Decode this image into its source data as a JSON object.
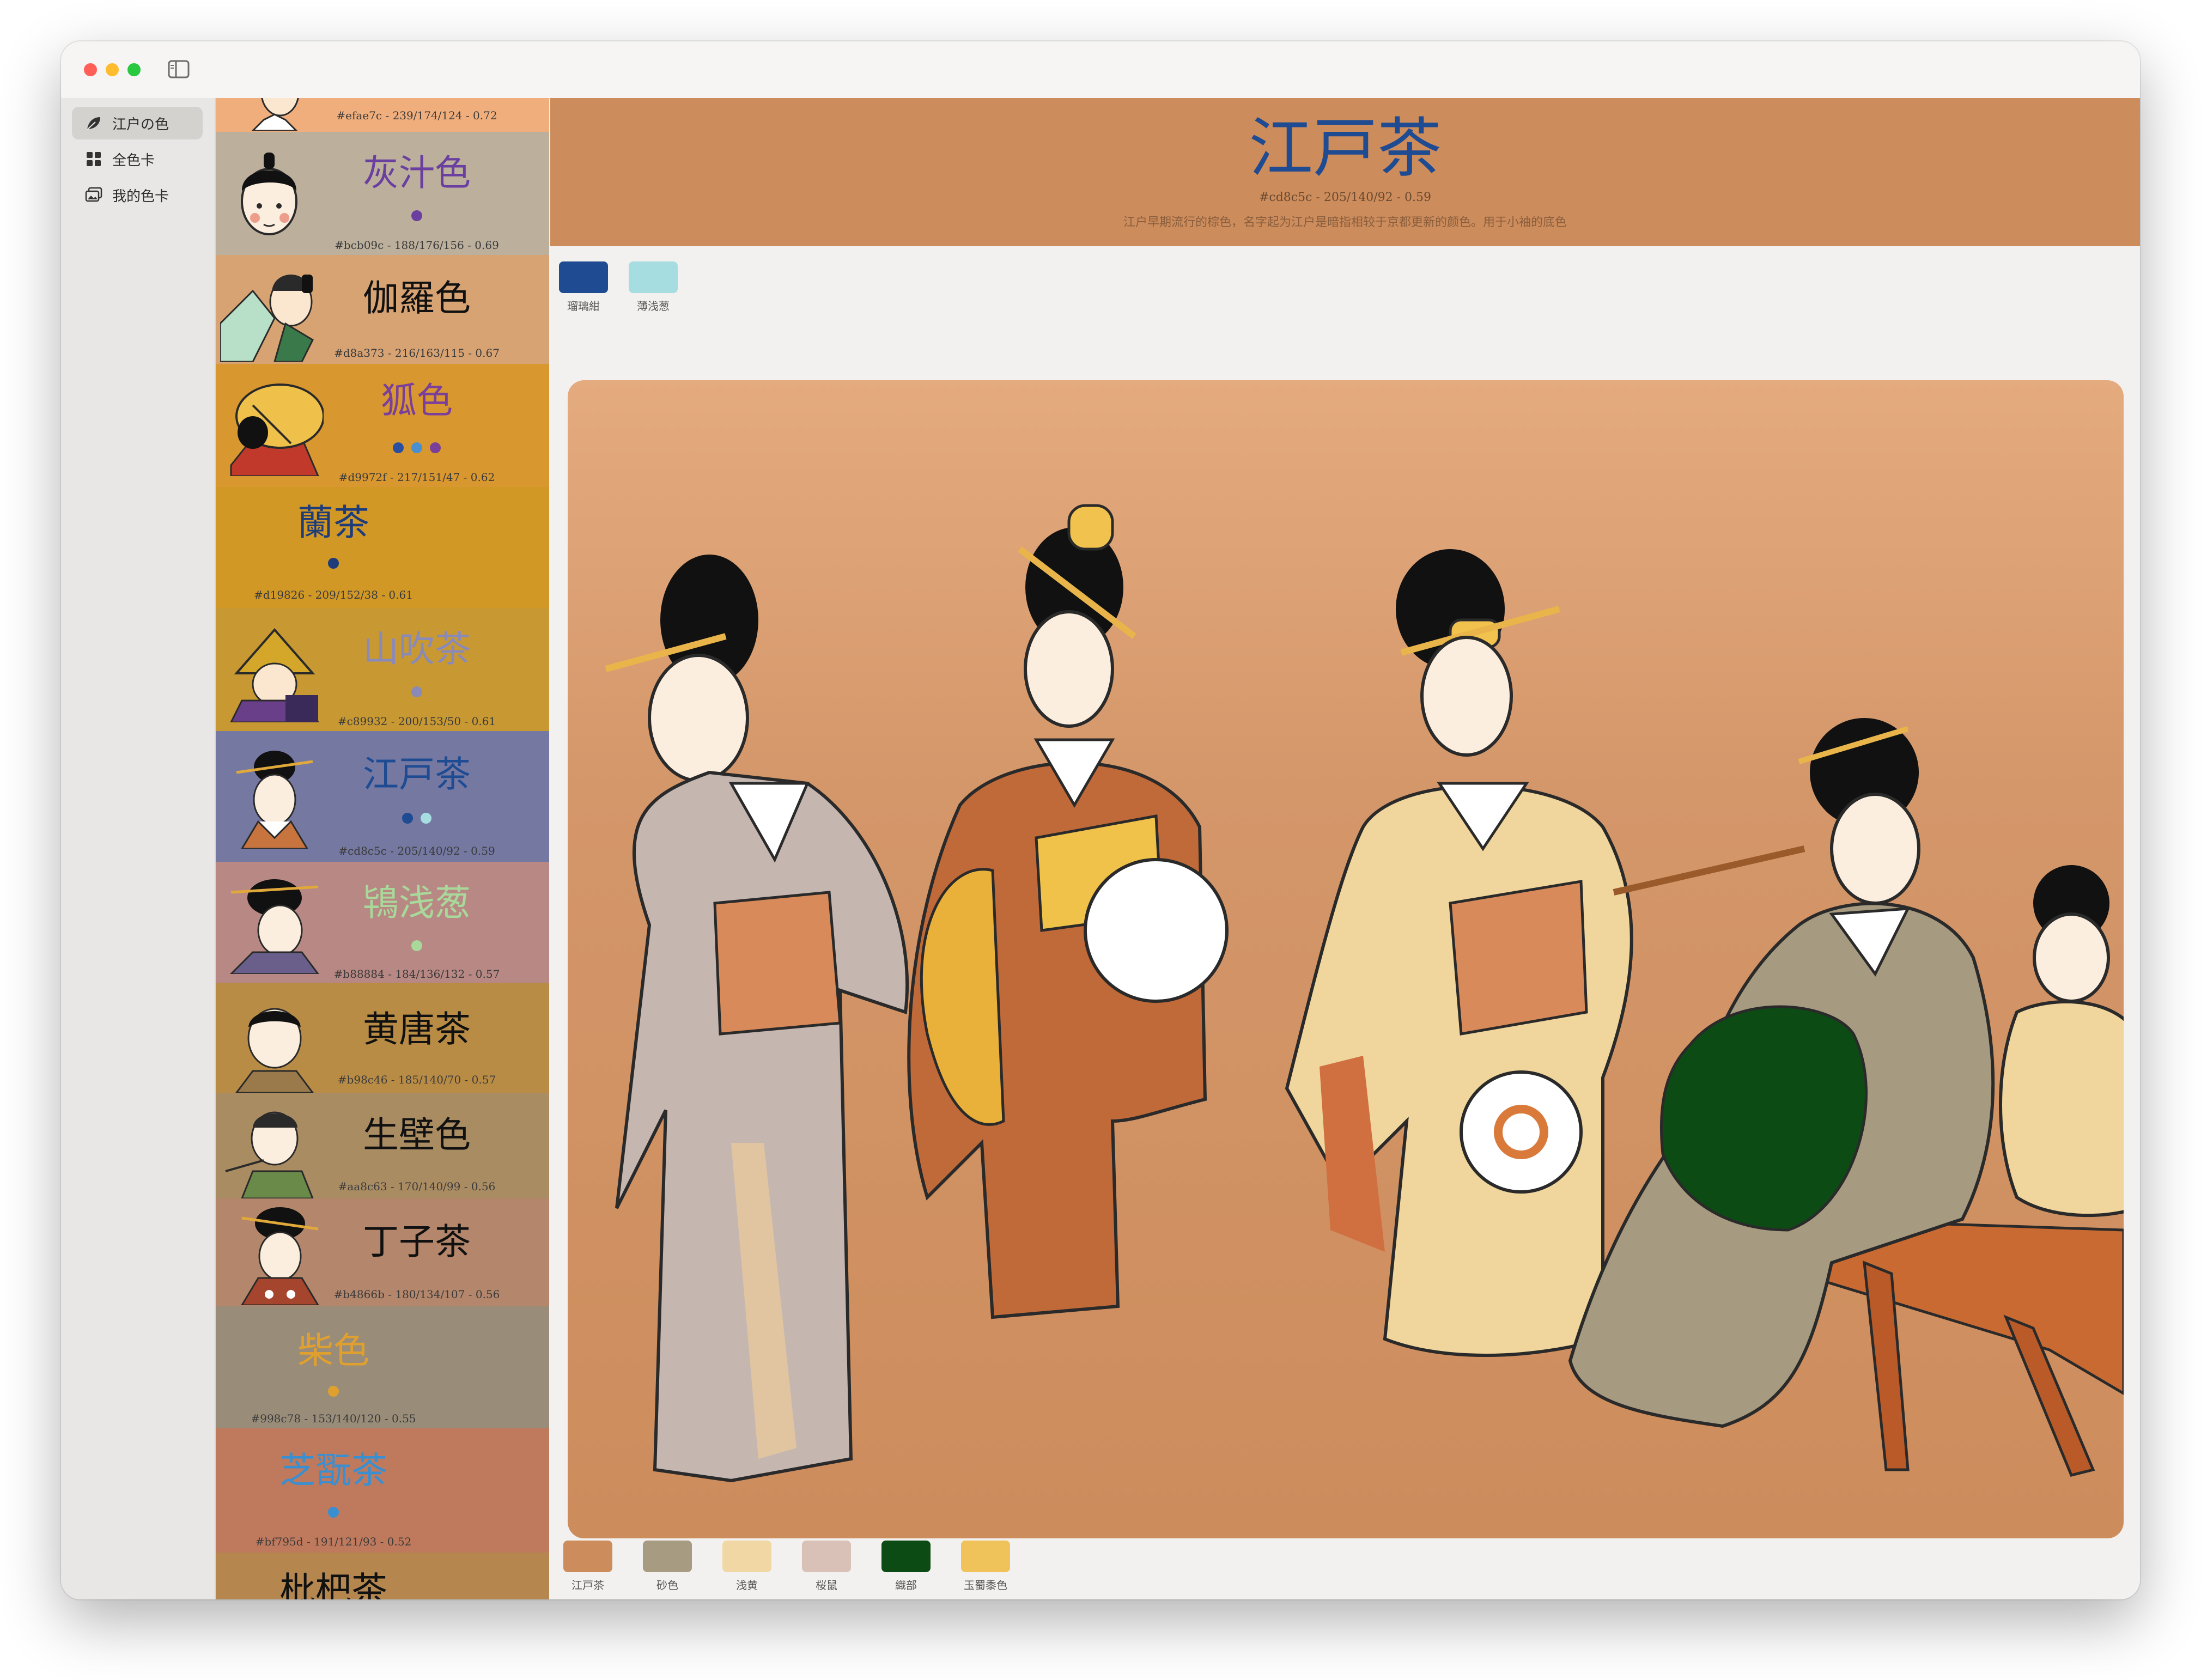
{
  "sidebar": {
    "items": [
      {
        "label": "江户の色",
        "icon": "leaf-icon",
        "selected": true
      },
      {
        "label": "全色卡",
        "icon": "grid-icon",
        "selected": false
      },
      {
        "label": "我的色卡",
        "icon": "photo-stack-icon",
        "selected": false
      }
    ]
  },
  "cards": [
    {
      "name": "",
      "info": "#efae7c - 239/174/124 - 0.72",
      "bg": "#efae7c"
    },
    {
      "name": "灰汁色",
      "info": "#bcb09c - 188/176/156 - 0.69",
      "bg": "#bcb09c",
      "name_color": "#6a3fa0",
      "dots": [
        "#6a3fa0"
      ]
    },
    {
      "name": "伽羅色",
      "info": "#d8a373 - 216/163/115 - 0.67",
      "bg": "#d8a373",
      "name_color": "#111111",
      "dots": []
    },
    {
      "name": "狐色",
      "info": "#d9972f - 217/151/47 - 0.62",
      "bg": "#d9972f",
      "name_color": "#7a3f9a",
      "dots": [
        "#2a4fa0",
        "#4a8fd0",
        "#7a3f9a"
      ]
    },
    {
      "name": "蘭茶",
      "info": "#d19826 - 209/152/38 - 0.61",
      "bg": "#d19826",
      "name_color": "#1e3c7a",
      "dots": [
        "#1e3c7a"
      ]
    },
    {
      "name": "山吹茶",
      "info": "#c89932 - 200/153/50 - 0.61",
      "bg": "#c89932",
      "name_color": "#8a8ab8",
      "dots": [
        "#8a8ab8"
      ]
    },
    {
      "name": "江戸茶",
      "info": "#cd8c5c - 205/140/92 - 0.59",
      "bg": "#7579a2",
      "name_color": "#1e4b92",
      "dots": [
        "#1e4b92",
        "#a6dde0"
      ]
    },
    {
      "name": "鴇浅葱",
      "info": "#b88884 - 184/136/132 - 0.57",
      "bg": "#b88884",
      "name_color": "#a9d99a",
      "dots": [
        "#a9d99a"
      ]
    },
    {
      "name": "黄唐茶",
      "info": "#b98c46 - 185/140/70 - 0.57",
      "bg": "#b98c46",
      "name_color": "#111111",
      "dots": []
    },
    {
      "name": "生壁色",
      "info": "#aa8c63 - 170/140/99 - 0.56",
      "bg": "#aa8c63",
      "name_color": "#111111",
      "dots": []
    },
    {
      "name": "丁子茶",
      "info": "#b4866b - 180/134/107 - 0.56",
      "bg": "#b4866b",
      "name_color": "#111111",
      "dots": []
    },
    {
      "name": "柴色",
      "info": "#998c78 - 153/140/120 - 0.55",
      "bg": "#998c78",
      "name_color": "#e0a030",
      "dots": [
        "#e0a030"
      ]
    },
    {
      "name": "芝翫茶",
      "info": "#bf795d - 191/121/93 - 0.52",
      "bg": "#bf795d",
      "name_color": "#3a8fd0",
      "dots": [
        "#3a8fd0"
      ]
    },
    {
      "name": "枇杷茶",
      "info": "",
      "bg": "#b5874f",
      "name_color": "#111111",
      "dots": []
    }
  ],
  "detail": {
    "title": "江戸茶",
    "title_color": "#1e4b92",
    "banner_color": "#cd8c5c",
    "info": "#cd8c5c - 205/140/92 - 0.59",
    "description": "江户早期流行的棕色，名字起为江户是暗指相较于京都更新的颜色。用于小袖的底色",
    "match_colors": [
      {
        "label": "瑠璃紺",
        "color": "#1e4b92"
      },
      {
        "label": "薄浅葱",
        "color": "#a6dde0"
      }
    ],
    "palette": [
      {
        "label": "江戸茶",
        "color": "#cd8c5c"
      },
      {
        "label": "砂色",
        "color": "#a79c82"
      },
      {
        "label": "浅黄",
        "color": "#f0d7a4"
      },
      {
        "label": "桜鼠",
        "color": "#d9c1b8"
      },
      {
        "label": "織部",
        "color": "#0d4b14"
      },
      {
        "label": "玉蜀黍色",
        "color": "#f0c25a"
      }
    ]
  }
}
